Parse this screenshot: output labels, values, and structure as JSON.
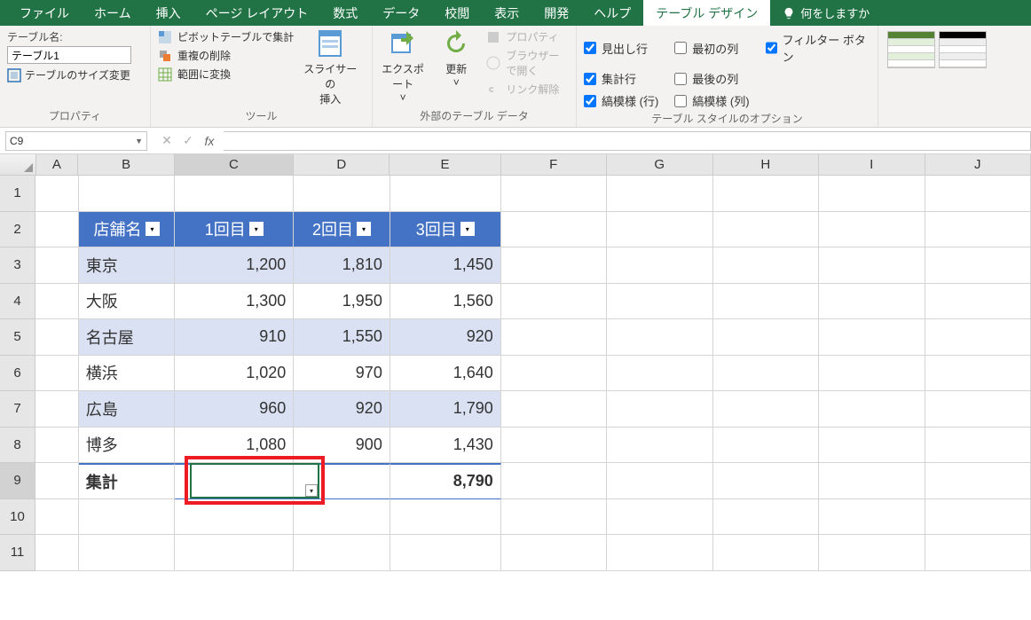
{
  "tabs": [
    "ファイル",
    "ホーム",
    "挿入",
    "ページ レイアウト",
    "数式",
    "データ",
    "校閲",
    "表示",
    "開発",
    "ヘルプ",
    "テーブル デザイン"
  ],
  "active_tab_index": 10,
  "tell_me": "何をしますか",
  "ribbon": {
    "properties": {
      "label": "プロパティ",
      "table_name_label": "テーブル名:",
      "table_name_value": "テーブル1",
      "resize": "テーブルのサイズ変更"
    },
    "tools": {
      "label": "ツール",
      "pivot": "ピボットテーブルで集計",
      "dedup": "重複の削除",
      "range": "範囲に変換",
      "slicer": "スライサーの\n挿入"
    },
    "external": {
      "label": "外部のテーブル データ",
      "export": "エクスポート",
      "refresh": "更新",
      "props": "プロパティ",
      "browser": "ブラウザーで開く",
      "unlink": "リンク解除"
    },
    "options": {
      "label": "テーブル スタイルのオプション",
      "header_row": "見出し行",
      "total_row": "集計行",
      "banded_rows": "縞模様 (行)",
      "first_col": "最初の列",
      "last_col": "最後の列",
      "banded_cols": "縞模様 (列)",
      "filter_btn": "フィルター ボタン",
      "checked": {
        "header_row": true,
        "total_row": true,
        "banded_rows": true,
        "first_col": false,
        "last_col": false,
        "banded_cols": false,
        "filter_btn": true
      }
    }
  },
  "formula_bar": {
    "namebox": "C9",
    "formula": ""
  },
  "grid": {
    "columns": [
      "A",
      "B",
      "C",
      "D",
      "E",
      "F",
      "G",
      "H",
      "I",
      "J"
    ],
    "row_numbers": [
      1,
      2,
      3,
      4,
      5,
      6,
      7,
      8,
      9,
      10,
      11
    ],
    "selected_cell": "C9",
    "table": {
      "headers": [
        "店舗名",
        "1回目",
        "2回目",
        "3回目"
      ],
      "rows": [
        [
          "東京",
          "1,200",
          "1,810",
          "1,450"
        ],
        [
          "大阪",
          "1,300",
          "1,950",
          "1,560"
        ],
        [
          "名古屋",
          "910",
          "1,550",
          "920"
        ],
        [
          "横浜",
          "1,020",
          "970",
          "1,640"
        ],
        [
          "広島",
          "960",
          "920",
          "1,790"
        ],
        [
          "博多",
          "1,080",
          "900",
          "1,430"
        ]
      ],
      "total_label": "集計",
      "total_values": [
        "",
        "",
        "8,790"
      ]
    }
  }
}
